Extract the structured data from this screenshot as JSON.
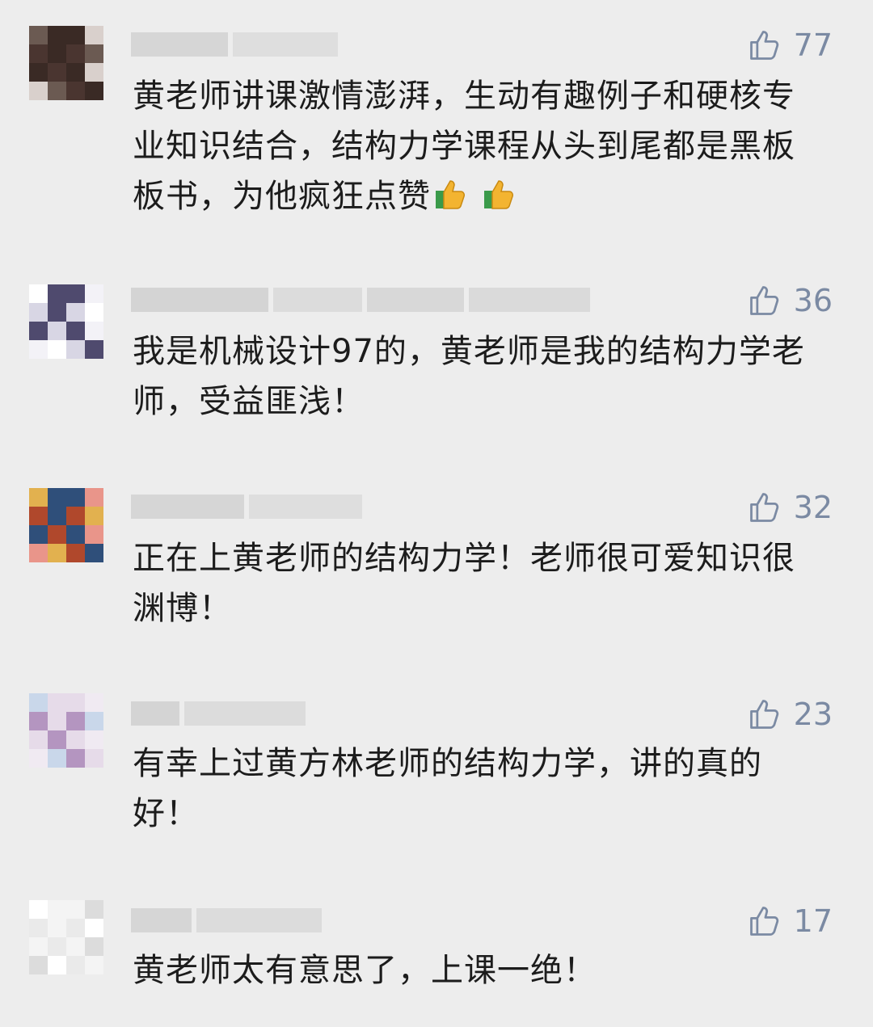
{
  "comments": [
    {
      "likes": "77",
      "text": "黄老师讲课激情澎湃，生动有趣例子和硬核专业知识结合，结构力学课程从头到尾都是黑板板书，为他疯狂点赞",
      "emoji": [
        "thumbs-up-icon",
        "thumbs-up-icon"
      ],
      "avatar_colors": [
        "#6b5a52",
        "#3a2a25",
        "#4a3530",
        "#d9d0cc"
      ]
    },
    {
      "likes": "36",
      "text": "我是机械设计97的，黄老师是我的结构力学老师，受益匪浅！",
      "avatar_colors": [
        "#ffffff",
        "#4f4a6e",
        "#d8d6e4",
        "#f3f2f7"
      ]
    },
    {
      "likes": "32",
      "text": "正在上黄老师的结构力学！老师很可爱知识很渊博！",
      "avatar_colors": [
        "#e2b14f",
        "#2f4f7a",
        "#b0482c",
        "#e9958a"
      ]
    },
    {
      "likes": "23",
      "text": "有幸上过黄方林老师的结构力学，讲的真的好！",
      "avatar_colors": [
        "#c9d7ea",
        "#e6dbe9",
        "#b495c0",
        "#f0eaf2"
      ]
    },
    {
      "likes": "17",
      "text": "黄老师太有意思了，上课一绝！",
      "avatar_colors": [
        "#ffffff",
        "#f4f4f4",
        "#eaeaea",
        "#dcdcdc"
      ]
    }
  ],
  "colors": {
    "background": "#ededed",
    "text": "#1c1c1c",
    "like": "#7b8aa3",
    "blur": "#d2d2d2"
  }
}
